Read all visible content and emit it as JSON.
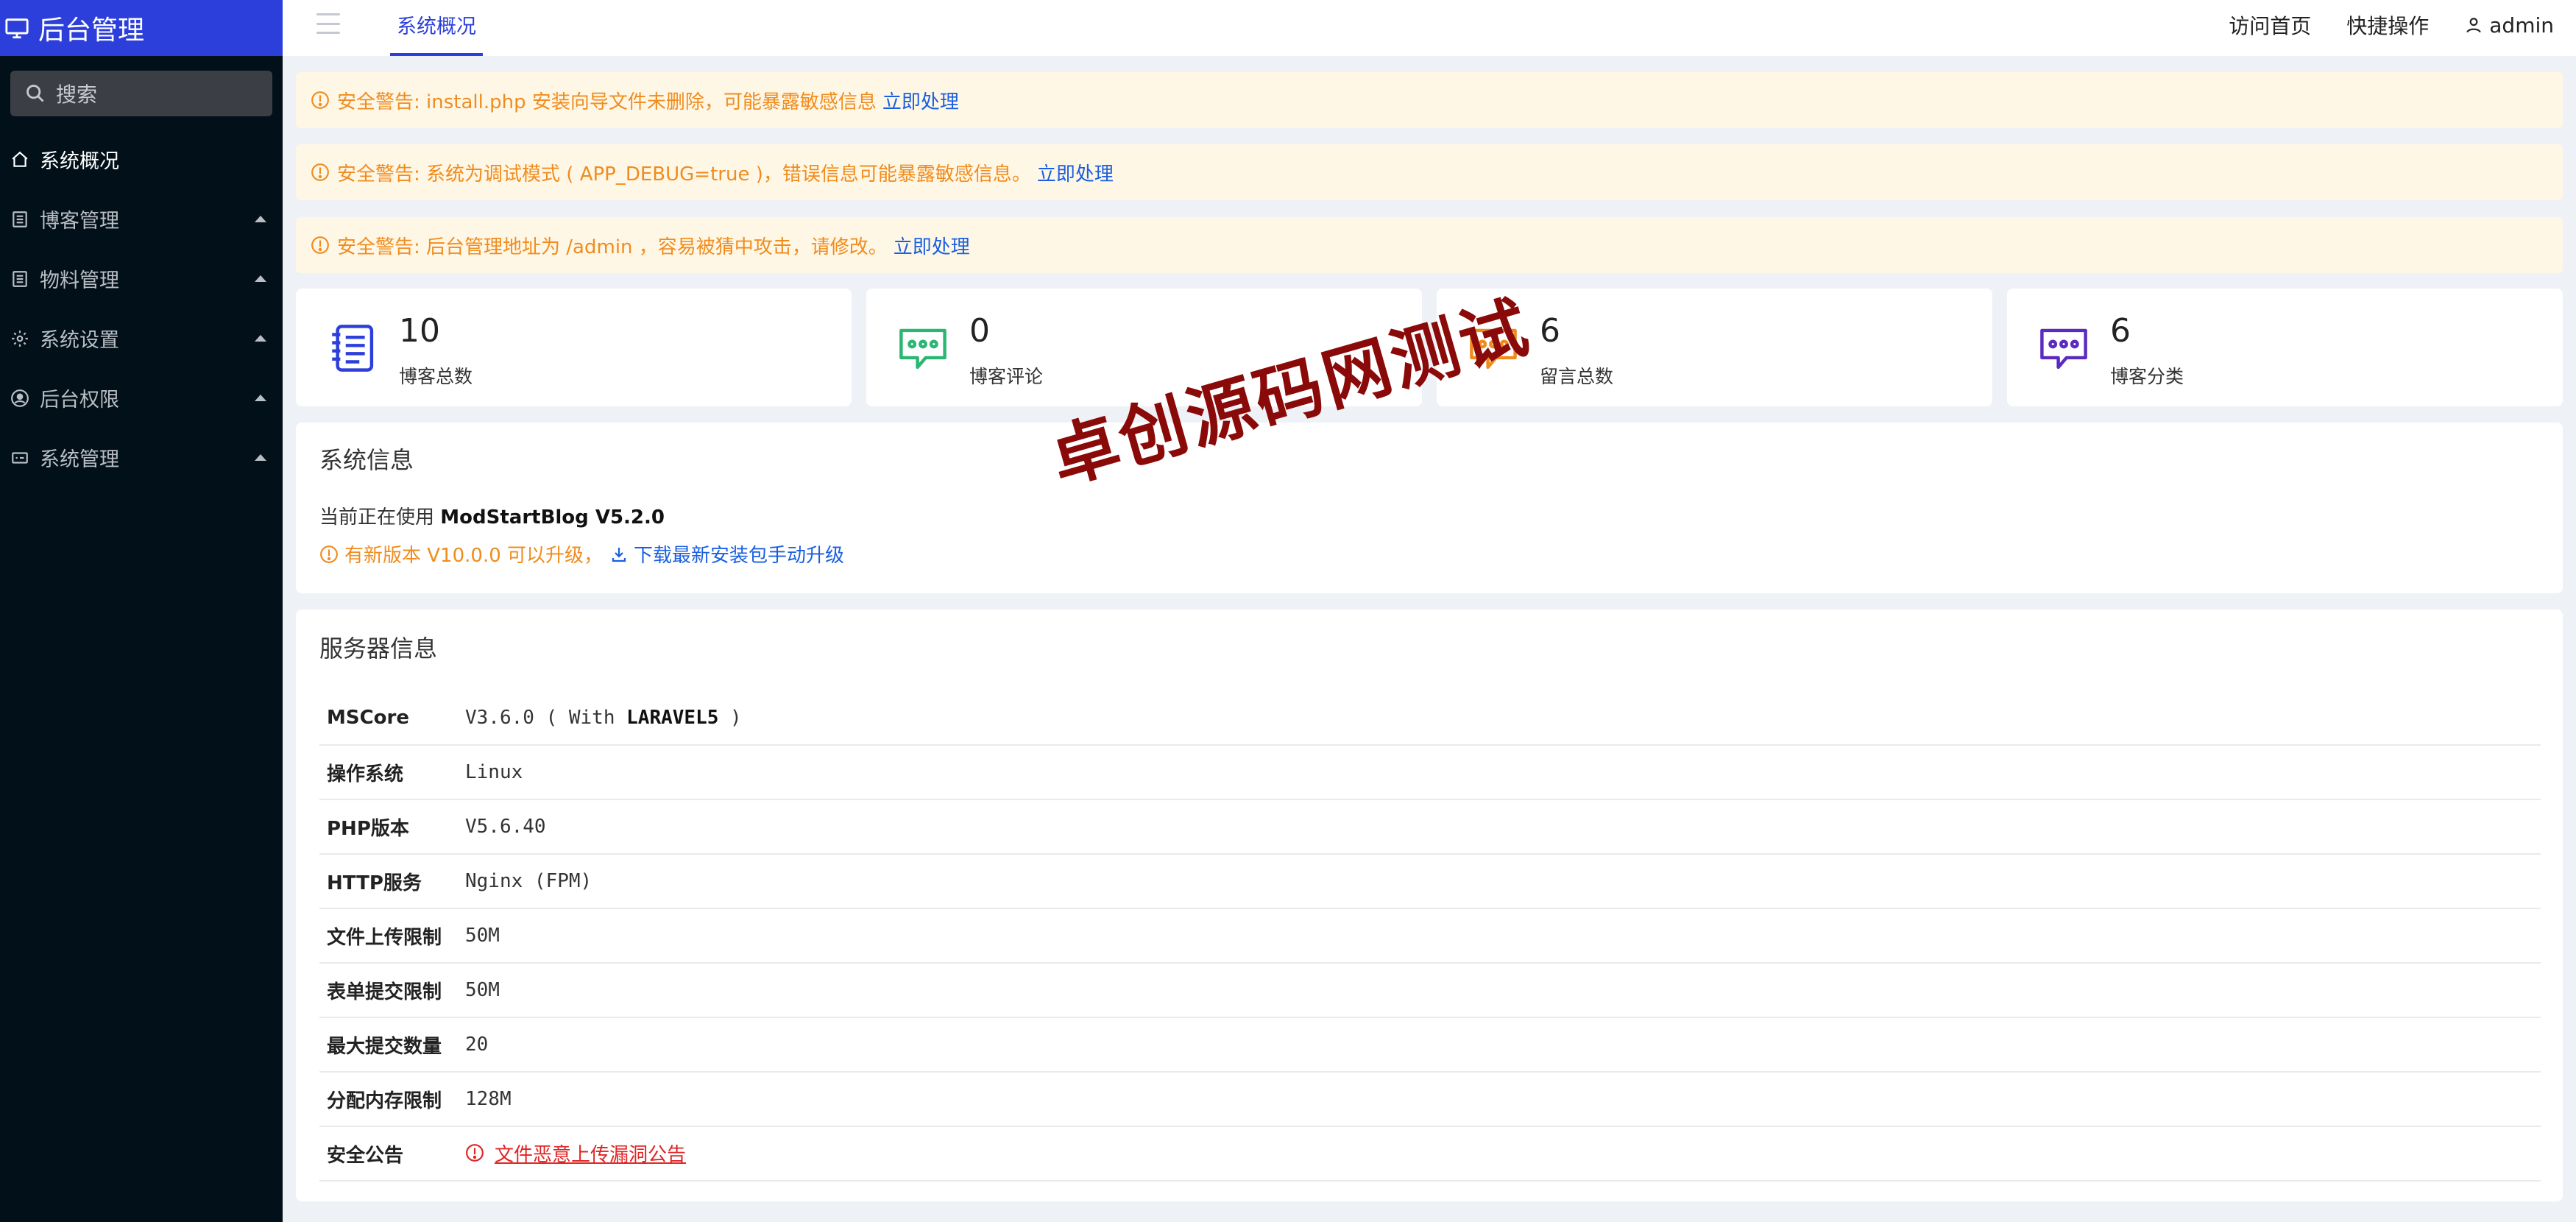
{
  "sidebar": {
    "brand": "后台管理",
    "search_placeholder": "搜索",
    "items": [
      {
        "label": "系统概况"
      },
      {
        "label": "博客管理"
      },
      {
        "label": "物料管理"
      },
      {
        "label": "系统设置"
      },
      {
        "label": "后台权限"
      },
      {
        "label": "系统管理"
      }
    ]
  },
  "header": {
    "tab": "系统概况",
    "links": [
      "访问首页",
      "快捷操作"
    ],
    "user": "admin"
  },
  "alerts": [
    {
      "text": "安全警告: install.php 安装向导文件未删除，可能暴露敏感信息",
      "action": "立即处理"
    },
    {
      "text": "安全警告: 系统为调试模式 ( APP_DEBUG=true )，错误信息可能暴露敏感信息。",
      "action": "立即处理"
    },
    {
      "text": "安全警告: 后台管理地址为 /admin ，容易被猜中攻击，请修改。",
      "action": "立即处理"
    }
  ],
  "stats": [
    {
      "value": "10",
      "label": "博客总数",
      "color": "#2c3fdb"
    },
    {
      "value": "0",
      "label": "博客评论",
      "color": "#2bb673"
    },
    {
      "value": "6",
      "label": "留言总数",
      "color": "#f08c1e"
    },
    {
      "value": "6",
      "label": "博客分类",
      "color": "#5b2bbf"
    }
  ],
  "system_info": {
    "title": "系统信息",
    "using_prefix": "当前正在使用",
    "product": "ModStartBlog V5.2.0",
    "upgrade_text": "有新版本 V10.0.0 可以升级，",
    "download_text": "下载最新安装包手动升级"
  },
  "server_info": {
    "title": "服务器信息",
    "rows": [
      {
        "key": "MSCore",
        "value_a": "V3.6.0 ( With",
        "value_b": "LARAVEL5",
        "value_c": ")"
      },
      {
        "key": "操作系统",
        "value": "Linux"
      },
      {
        "key": "PHP版本",
        "value": "V5.6.40"
      },
      {
        "key": "HTTP服务",
        "value": "Nginx (FPM)"
      },
      {
        "key": "文件上传限制",
        "value": "50M"
      },
      {
        "key": "表单提交限制",
        "value": "50M"
      },
      {
        "key": "最大提交数量",
        "value": "20"
      },
      {
        "key": "分配内存限制",
        "value": "128M"
      },
      {
        "key": "安全公告",
        "value": "文件恶意上传漏洞公告"
      }
    ]
  },
  "watermark": "卓创源码网测试"
}
